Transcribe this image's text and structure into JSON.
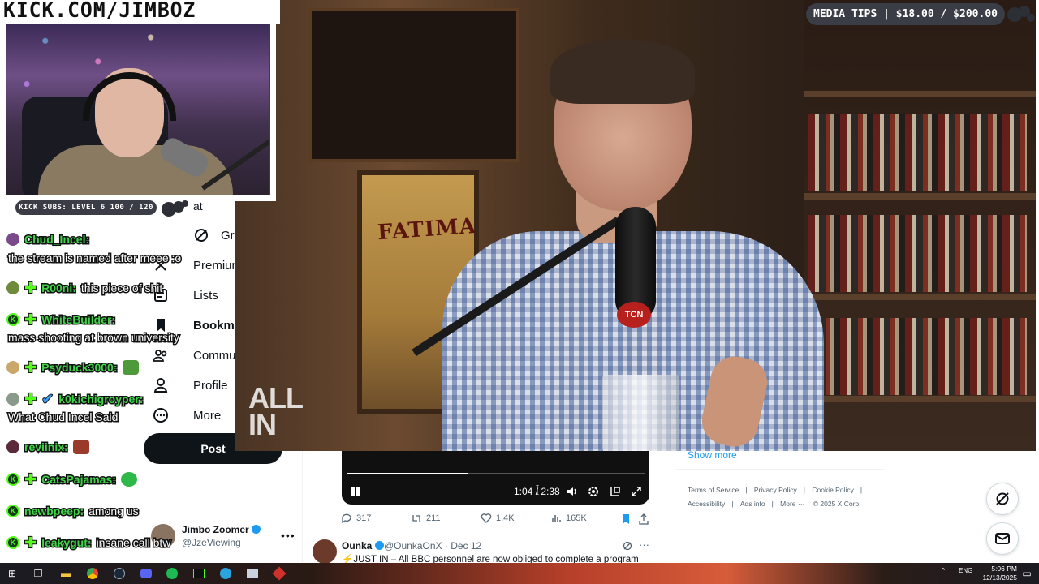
{
  "stream": {
    "banner": "KICK.COM/JIMBOZ",
    "subs_label": "KICK SUBS: LEVEL 6 100 / 120",
    "media_tips": "MEDIA TIPS | $18.00 / $200.00"
  },
  "chat": [
    {
      "user": "Chud_Incel:",
      "message": "the stream is named after meee :o"
    },
    {
      "user": "R00ni:",
      "message": "this piece of shit"
    },
    {
      "user": "WhiteBuilder:",
      "message": "mass shooting at brown university"
    },
    {
      "user": "Psyduck3000:",
      "message": ""
    },
    {
      "user": "k0kichigroyper:",
      "message": "What Chud Incel Said"
    },
    {
      "user": "reviinix:",
      "message": ""
    },
    {
      "user": "CatsPajamas:",
      "message": ""
    },
    {
      "user": "newbpeep:",
      "message": "among us"
    },
    {
      "user": "leakygut:",
      "message": "insane call btw"
    }
  ],
  "nav": {
    "partial_top": "at",
    "items": [
      {
        "label": "Grok",
        "icon": "grok-icon"
      },
      {
        "label": "Premium",
        "icon": "x-icon"
      },
      {
        "label": "Lists",
        "icon": "list-icon"
      },
      {
        "label": "Bookmarks",
        "icon": "bookmark-icon"
      },
      {
        "label": "Communities",
        "icon": "communities-icon"
      },
      {
        "label": "Profile",
        "icon": "profile-icon"
      },
      {
        "label": "More",
        "icon": "more-circle-icon"
      }
    ],
    "post_button": "Post"
  },
  "account": {
    "name": "Jimbo Zoomer",
    "handle": "@JzeViewing"
  },
  "video": {
    "overlay_logo_line1": "ALL",
    "overlay_logo_line2": "IN",
    "mic_badge": "TCN",
    "poster_text": "FATIMA",
    "time_current": "1:04",
    "time_total": "2:38",
    "time_display": "1:04 / 2:38",
    "progress": 0.405
  },
  "tweet_actions": {
    "replies": "317",
    "reposts": "211",
    "likes": "1.4K",
    "views": "165K"
  },
  "tweet2": {
    "name": "Ounka",
    "handle": "@OunkaOnX · Dec 12",
    "text": "⚡JUST IN – All BBC personnel are now obliged to complete a program"
  },
  "sidebar": {
    "show_more": "Show more",
    "footer_line1": [
      "Terms of Service",
      "Privacy Policy",
      "Cookie Policy"
    ],
    "footer_line2": [
      "Accessibility",
      "Ads info",
      "More ···",
      "© 2025 X Corp."
    ]
  },
  "taskbar": {
    "lang": "ENG",
    "time": "5:06 PM",
    "date": "12/13/2025"
  },
  "colors": {
    "kick_green": "#53fc18",
    "x_blue": "#1d9bf0",
    "chat_name": "#40d34a"
  }
}
